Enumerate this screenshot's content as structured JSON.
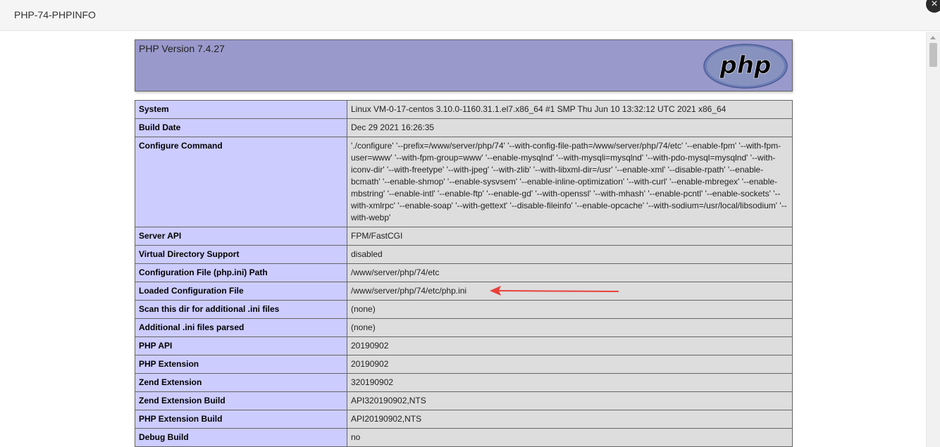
{
  "dialog": {
    "title": "PHP-74-PHPINFO",
    "close_label": "×"
  },
  "header": {
    "version_text": "PHP Version 7.4.27",
    "logo_text": "php"
  },
  "rows": [
    {
      "key": "System",
      "value": "Linux VM-0-17-centos 3.10.0-1160.31.1.el7.x86_64 #1 SMP Thu Jun 10 13:32:12 UTC 2021 x86_64"
    },
    {
      "key": "Build Date",
      "value": "Dec 29 2021 16:26:35"
    },
    {
      "key": "Configure Command",
      "value": "'./configure' '--prefix=/www/server/php/74' '--with-config-file-path=/www/server/php/74/etc' '--enable-fpm' '--with-fpm-user=www' '--with-fpm-group=www' '--enable-mysqlnd' '--with-mysqli=mysqlnd' '--with-pdo-mysql=mysqlnd' '--with-iconv-dir' '--with-freetype' '--with-jpeg' '--with-zlib' '--with-libxml-dir=/usr' '--enable-xml' '--disable-rpath' '--enable-bcmath' '--enable-shmop' '--enable-sysvsem' '--enable-inline-optimization' '--with-curl' '--enable-mbregex' '--enable-mbstring' '--enable-intl' '--enable-ftp' '--enable-gd' '--with-openssl' '--with-mhash' '--enable-pcntl' '--enable-sockets' '--with-xmlrpc' '--enable-soap' '--with-gettext' '--disable-fileinfo' '--enable-opcache' '--with-sodium=/usr/local/libsodium' '--with-webp'"
    },
    {
      "key": "Server API",
      "value": "FPM/FastCGI"
    },
    {
      "key": "Virtual Directory Support",
      "value": "disabled"
    },
    {
      "key": "Configuration File (php.ini) Path",
      "value": "/www/server/php/74/etc"
    },
    {
      "key": "Loaded Configuration File",
      "value": "/www/server/php/74/etc/php.ini"
    },
    {
      "key": "Scan this dir for additional .ini files",
      "value": "(none)"
    },
    {
      "key": "Additional .ini files parsed",
      "value": "(none)"
    },
    {
      "key": "PHP API",
      "value": "20190902"
    },
    {
      "key": "PHP Extension",
      "value": "20190902"
    },
    {
      "key": "Zend Extension",
      "value": "320190902"
    },
    {
      "key": "Zend Extension Build",
      "value": "API320190902,NTS"
    },
    {
      "key": "PHP Extension Build",
      "value": "API20190902,NTS"
    },
    {
      "key": "Debug Build",
      "value": "no"
    },
    {
      "key": "",
      "value": ""
    }
  ],
  "colors": {
    "header_bg": "#9999cc",
    "key_bg": "#ccccff",
    "value_bg": "#dddddd",
    "annotation_arrow": "#e8403a"
  }
}
